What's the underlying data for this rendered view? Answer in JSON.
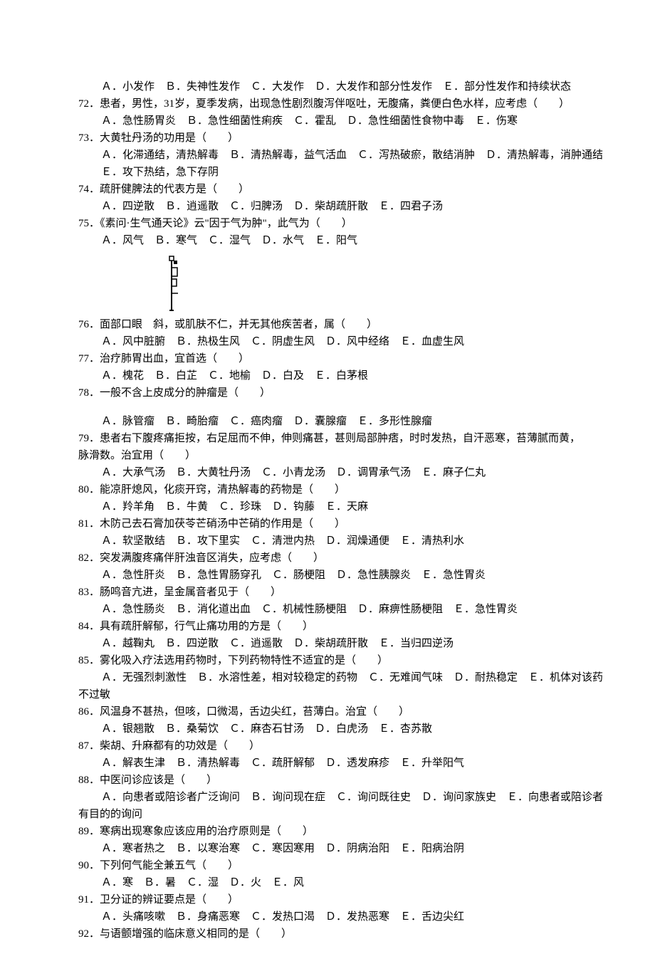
{
  "lines": [
    {
      "cls": "indent",
      "text": "Ａ．小发作　Ｂ．失神性发作　Ｃ．大发作　Ｄ．大发作和部分性发作　Ｅ．部分性发作和持续状态"
    },
    {
      "cls": "",
      "text": "72．患者，男性，31岁，夏季发病，出现急性剧烈腹泻伴呕吐，无腹痛，粪便白色水样，应考虑（　　）"
    },
    {
      "cls": "indent",
      "text": "Ａ．急性肠胃炎　Ｂ．急性细菌性痢疾　Ｃ．霍乱　Ｄ．急性细菌性食物中毒　Ｅ．伤寒"
    },
    {
      "cls": "",
      "text": "73．大黄牡丹汤的功用是（　　）"
    },
    {
      "cls": "indent",
      "text": "Ａ．化滞通结，清热解毒　Ｂ．清热解毒，益气活血　Ｃ．泻热破瘀，散结消肿　Ｄ．清热解毒，消肿通结"
    },
    {
      "cls": "indent",
      "text": "Ｅ．攻下热结，急下存阴"
    },
    {
      "cls": "",
      "text": "74．疏肝健脾法的代表方是（　　）"
    },
    {
      "cls": "indent",
      "text": "Ａ．四逆散　Ｂ．逍遥散　Ｃ．归脾汤　Ｄ．柴胡疏肝散　Ｅ．四君子汤"
    },
    {
      "cls": "",
      "text": "75．《素问·生气通天论》云\"因于气为肿\"，此气为（　　）"
    },
    {
      "cls": "indent",
      "text": "Ａ．风气　Ｂ．寒气　Ｃ．湿气　Ｄ．水气　Ｅ．阳气"
    },
    {
      "cls": "image",
      "text": ""
    },
    {
      "cls": "",
      "text": "76．面部口眼　斜，或肌肤不仁，并无其他疾苦者，属（　　）"
    },
    {
      "cls": "indent",
      "text": "Ａ．风中脏腑　Ｂ．热极生风　Ｃ．阴虚生风　Ｄ．风中经络　Ｅ．血虚生风"
    },
    {
      "cls": "",
      "text": "77．治疗肺胃出血，宜首选（　　）"
    },
    {
      "cls": "indent",
      "text": "Ａ．槐花　Ｂ．白芷　Ｃ．地榆　Ｄ．白及　Ｅ．白茅根"
    },
    {
      "cls": "",
      "text": "78．一般不含上皮成分的肿瘤是（　　）"
    },
    {
      "cls": "blank",
      "text": ""
    },
    {
      "cls": "indent",
      "text": "Ａ．脉管瘤　Ｂ．畸胎瘤　Ｃ．癌肉瘤　Ｄ．囊腺瘤　Ｅ．多形性腺瘤"
    },
    {
      "cls": "",
      "text": "79．患者右下腹疼痛拒按，右足屈而不伸，伸则痛甚，甚则局部肿痞，时时发热，自汗恶寒，苔薄腻而黄，"
    },
    {
      "cls": "",
      "text": "脉滑数。治宜用（　　）"
    },
    {
      "cls": "indent",
      "text": "Ａ．大承气汤　Ｂ．大黄牡丹汤　Ｃ．小青龙汤　Ｄ．调胃承气汤　Ｅ．麻子仁丸"
    },
    {
      "cls": "",
      "text": "80．能凉肝熄风，化痰开窍，清热解毒的药物是（　　）"
    },
    {
      "cls": "indent",
      "text": "Ａ．羚羊角　Ｂ．牛黄　Ｃ．珍珠　Ｄ．钩藤　Ｅ．天麻"
    },
    {
      "cls": "",
      "text": "81．木防己去石膏加茯苓芒硝汤中芒硝的作用是（　　）"
    },
    {
      "cls": "indent",
      "text": "Ａ．软坚散结　Ｂ．攻下里实　Ｃ．清泄内热　Ｄ．润燥通便　Ｅ．清热利水"
    },
    {
      "cls": "",
      "text": "82．突发满腹疼痛伴肝浊音区消失，应考虑（　　）"
    },
    {
      "cls": "indent",
      "text": "Ａ．急性肝炎　Ｂ．急性胃肠穿孔　Ｃ．肠梗阻　Ｄ．急性胰腺炎　Ｅ．急性胃炎"
    },
    {
      "cls": "",
      "text": "83．肠鸣音亢进，呈金属音者见于（　　）"
    },
    {
      "cls": "indent",
      "text": "Ａ．急性肠炎　Ｂ．消化道出血　Ｃ．机械性肠梗阻　Ｄ．麻痹性肠梗阻　Ｅ．急性胃炎"
    },
    {
      "cls": "",
      "text": "84．具有疏肝解郁，行气止痛功用的方是（　　）"
    },
    {
      "cls": "indent",
      "text": "Ａ．越鞠丸　Ｂ．四逆散　Ｃ．逍遥散　Ｄ．柴胡疏肝散　Ｅ．当归四逆汤"
    },
    {
      "cls": "",
      "text": "85．雾化吸入疗法选用药物时，下列药物特性不适宜的是（　　）"
    },
    {
      "cls": "indent",
      "text": "Ａ．无强烈刺激性　Ｂ．水溶性差，相对较稳定的药物　Ｃ．无难闻气味　Ｄ．耐热稳定　Ｅ．机体对该药"
    },
    {
      "cls": "",
      "text": "不过敏"
    },
    {
      "cls": "",
      "text": "86．风温身不甚热，但咳，口微渴，舌边尖红，苔薄白。治宜（　　）"
    },
    {
      "cls": "indent",
      "text": "Ａ．银翘散　Ｂ．桑菊饮　Ｃ．麻杏石甘汤　Ｄ．白虎汤　Ｅ．杏苏散"
    },
    {
      "cls": "",
      "text": "87．柴胡、升麻都有的功效是（　　）"
    },
    {
      "cls": "indent",
      "text": "Ａ．解表生津　Ｂ．清热解毒　Ｃ．疏肝解郁　Ｄ．透发麻疹　Ｅ．升举阳气"
    },
    {
      "cls": "",
      "text": "88．中医问诊应该是（　　）"
    },
    {
      "cls": "indent",
      "text": "Ａ．向患者或陪诊者广泛询问　Ｂ．询问现在症　Ｃ．询问既往史　Ｄ．询问家族史　Ｅ．向患者或陪诊者"
    },
    {
      "cls": "",
      "text": "有目的的询问"
    },
    {
      "cls": "",
      "text": "89．寒病出现寒象应该应用的治疗原则是（　　）"
    },
    {
      "cls": "indent",
      "text": "Ａ．寒者热之　Ｂ．以寒治寒　Ｃ．寒因寒用　Ｄ．阴病治阳　Ｅ．阳病治阴"
    },
    {
      "cls": "",
      "text": "90．下列何气能全兼五气（　　）"
    },
    {
      "cls": "indent",
      "text": "Ａ．寒　Ｂ．暑　Ｃ．湿　Ｄ．火　Ｅ．风"
    },
    {
      "cls": "",
      "text": "91．卫分证的辨证要点是（　　）"
    },
    {
      "cls": "indent",
      "text": "Ａ．头痛咳嗽　Ｂ．身痛恶寒　Ｃ．发热口渴　Ｄ．发热恶寒　Ｅ．舌边尖红"
    },
    {
      "cls": "",
      "text": "92．与语颤增强的临床意义相同的是（　　）"
    }
  ]
}
